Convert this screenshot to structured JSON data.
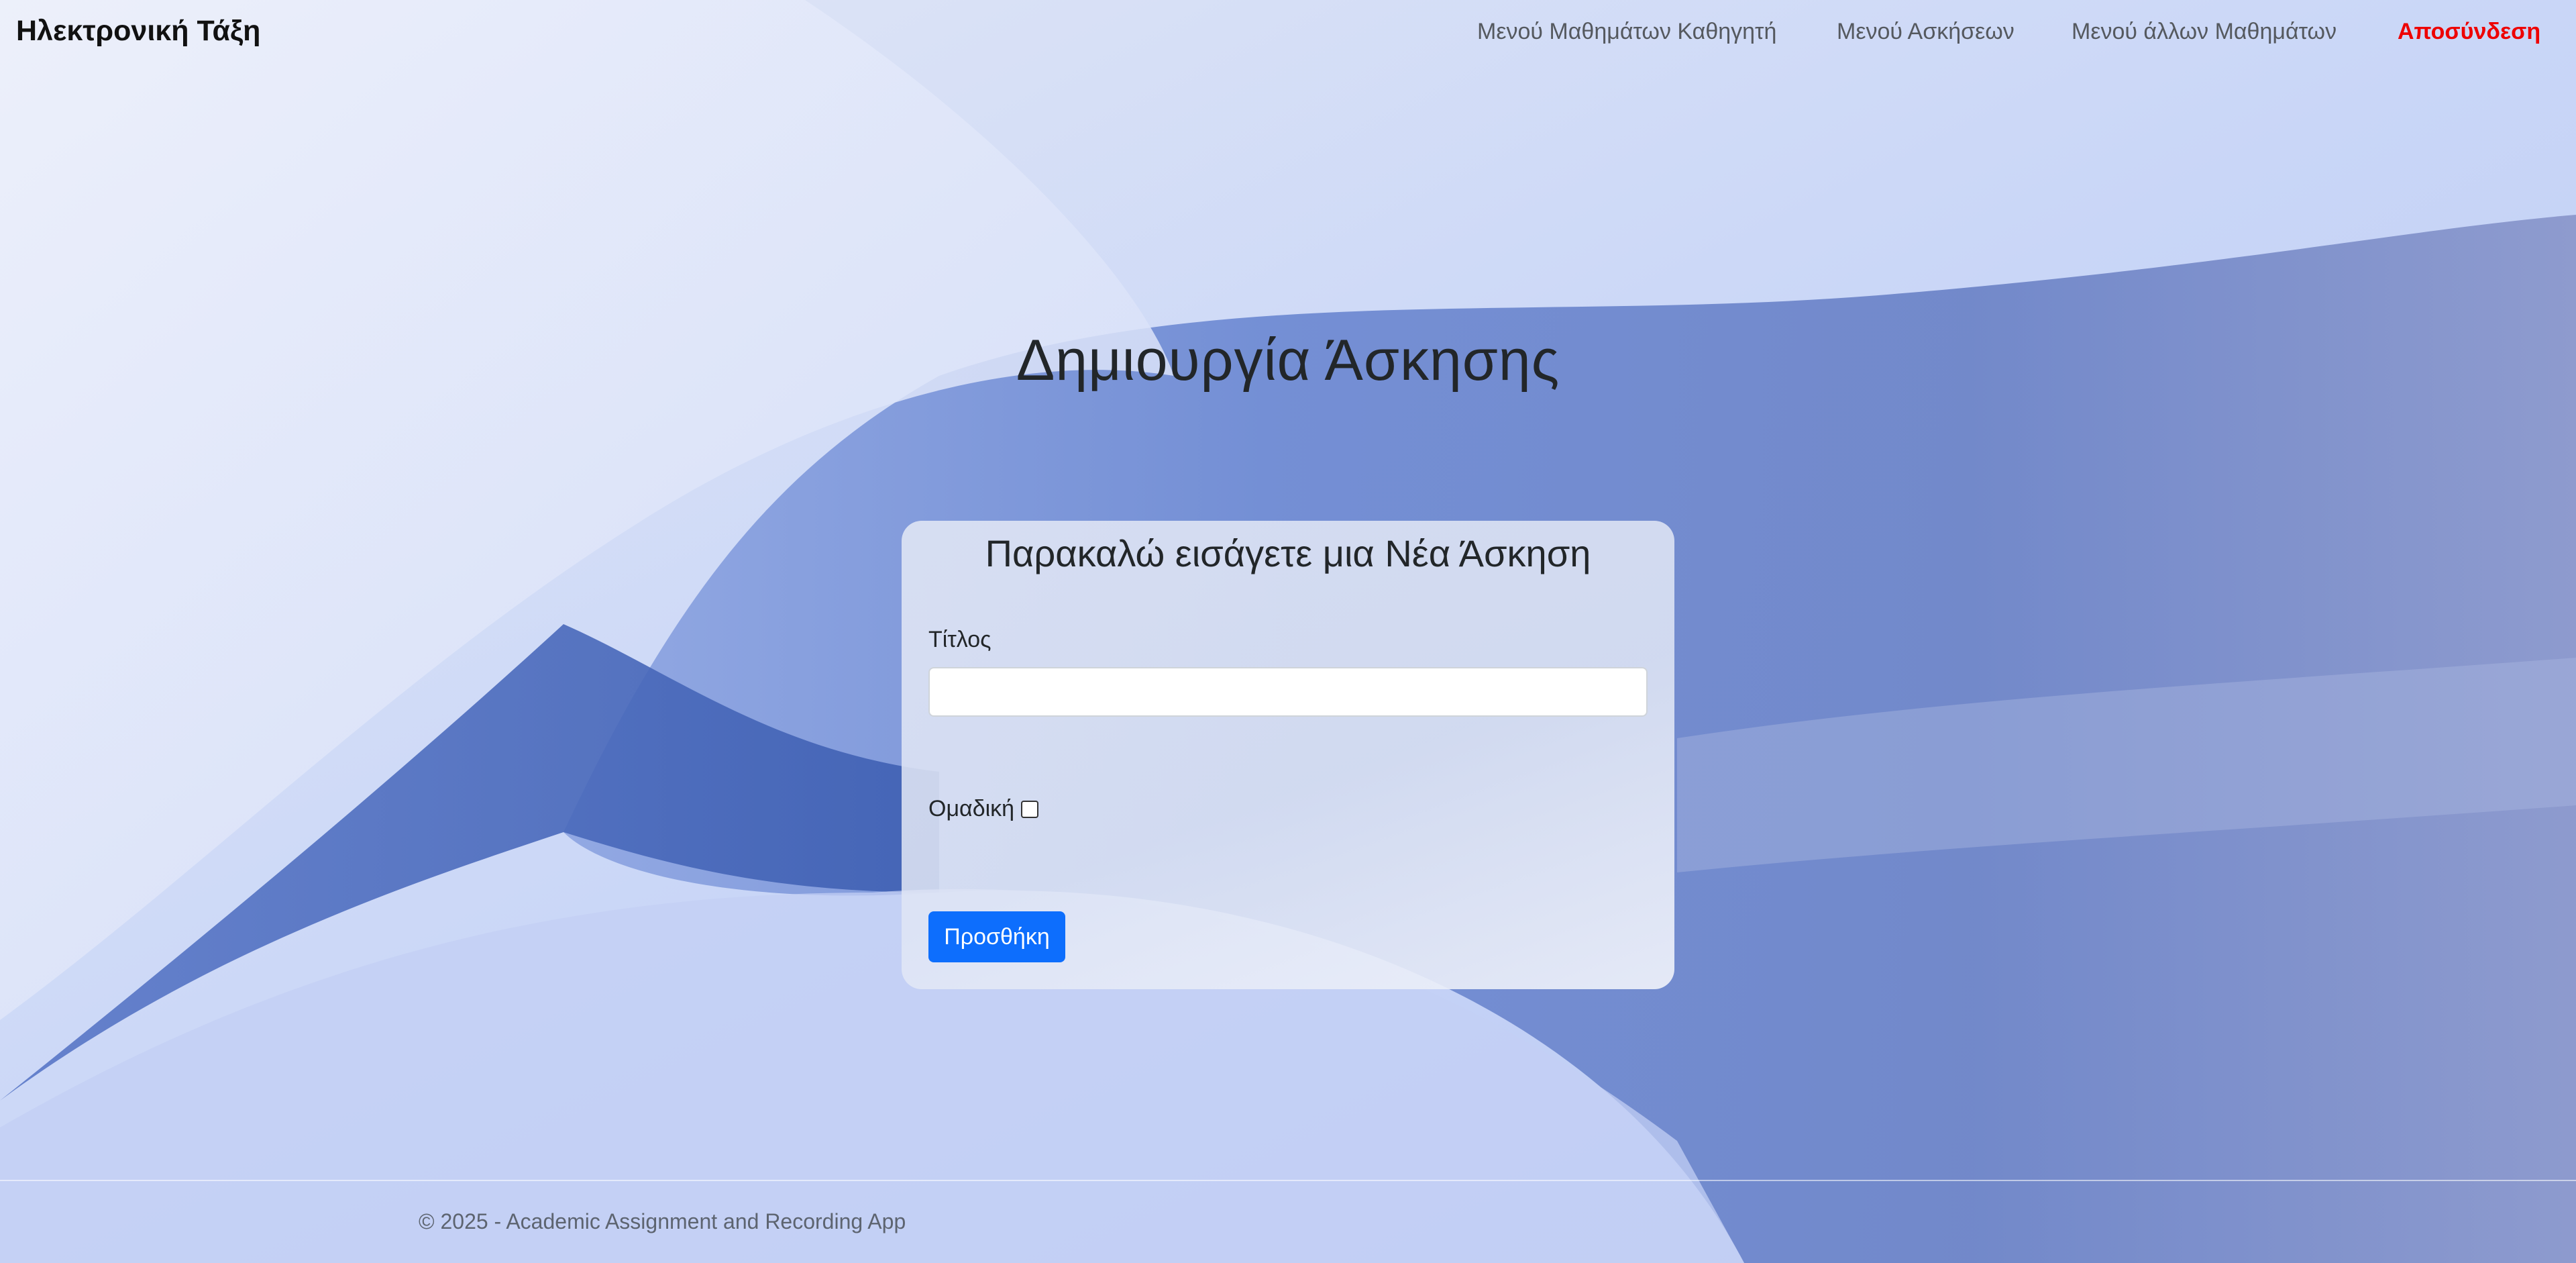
{
  "navbar": {
    "brand": "Ηλεκτρονική Τάξη",
    "links": [
      {
        "label": "Μενού Μαθημάτων Καθηγητή"
      },
      {
        "label": "Μενού Ασκήσεων"
      },
      {
        "label": "Μενού άλλων Μαθημάτων"
      },
      {
        "label": "Αποσύνδεση"
      }
    ]
  },
  "page": {
    "title": "Δημιουργία Άσκησης"
  },
  "form": {
    "heading": "Παρακαλώ εισάγετε μια Νέα Άσκηση",
    "title_label": "Τίτλος",
    "title_value": "",
    "group_label": "Ομαδική",
    "group_checked": false,
    "submit_label": "Προσθήκη"
  },
  "footer": {
    "text": "© 2025 - Academic Assignment and Recording App"
  },
  "colors": {
    "primary_button": "#0d6efd",
    "logout_link": "#ee0000",
    "background": "#c4d2f6"
  }
}
